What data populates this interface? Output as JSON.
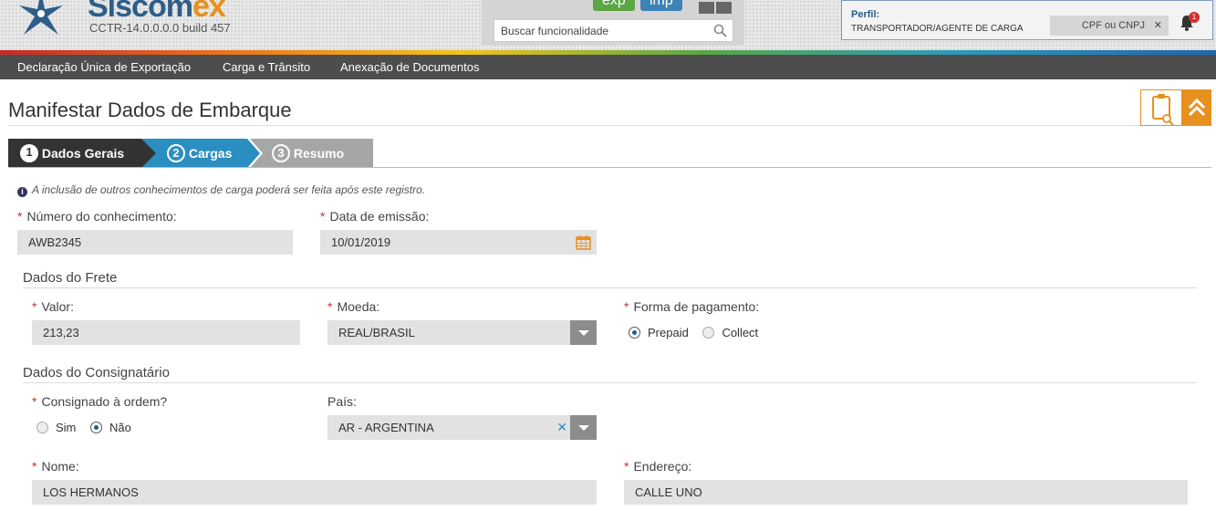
{
  "header": {
    "logo_text_a": "Siscom",
    "logo_text_b": "ex",
    "build": "CCTR-14.0.0.0.0 build 457",
    "badge_exp": "exp",
    "badge_imp": "imp",
    "search_placeholder": "Buscar funcionalidade",
    "profile_label": "Perfil:",
    "profile_value": "TRANSPORTADOR/AGENTE DE CARGA",
    "cpf_placeholder": "CPF ou CNPJ",
    "notification_count": "1"
  },
  "menu": [
    "Declaração Única de Exportação",
    "Carga e Trânsito",
    "Anexação de Documentos"
  ],
  "page_title": "Manifestar Dados de Embarque",
  "steps": [
    {
      "num": "1",
      "label": "Dados Gerais"
    },
    {
      "num": "2",
      "label": "Cargas"
    },
    {
      "num": "3",
      "label": "Resumo"
    }
  ],
  "info_text": "A inclusão de outros conhecimentos de carga poderá ser feita após este registro.",
  "form": {
    "required_mark": "*",
    "numero_label": "Número do conhecimento:",
    "numero_value": "AWB2345",
    "data_label": "Data de emissão:",
    "data_value": "10/01/2019",
    "frete_section": "Dados do Frete",
    "valor_label": "Valor:",
    "valor_value": "213,23",
    "moeda_label": "Moeda:",
    "moeda_value": "REAL/BRASIL",
    "pagamento_label": "Forma de pagamento:",
    "pagamento_options": [
      "Prepaid",
      "Collect"
    ],
    "pagamento_selected": "Prepaid",
    "consig_section": "Dados do Consignatário",
    "ordem_label": "Consignado à ordem?",
    "ordem_options": [
      "Sim",
      "Não"
    ],
    "ordem_selected": "Não",
    "pais_label": "País:",
    "pais_value": "AR - ARGENTINA",
    "nome_label": "Nome:",
    "nome_value": "LOS HERMANOS",
    "endereco_label": "Endereço:",
    "endereco_value": "CALLE UNO"
  },
  "colors": {
    "accent_orange": "#e8901e",
    "step_active_blue": "#2b8ec0",
    "menubar": "#4d4d4d",
    "required": "#c0392b"
  }
}
